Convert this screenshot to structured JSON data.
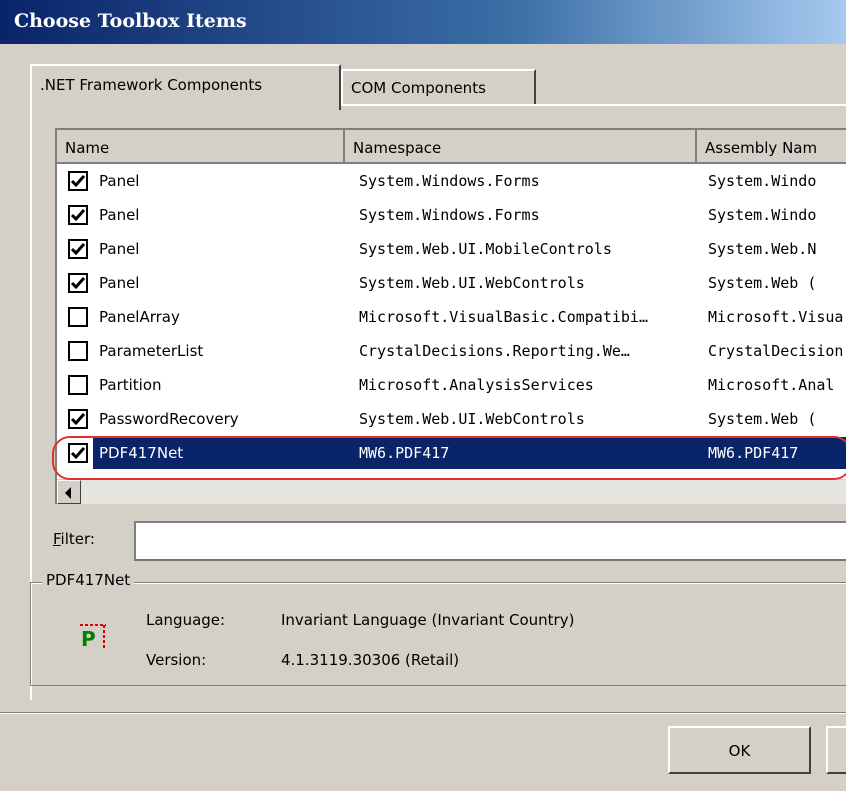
{
  "window": {
    "title": "Choose Toolbox Items"
  },
  "tabs": [
    {
      "label": ".NET Framework Components",
      "active": true
    },
    {
      "label": "COM Components",
      "active": false
    }
  ],
  "list": {
    "columns": [
      "Name",
      "Namespace",
      "Assembly Nam"
    ],
    "rows": [
      {
        "checked": true,
        "name": "Panel",
        "namespace": "System.Windows.Forms",
        "assembly": "System.Windo"
      },
      {
        "checked": true,
        "name": "Panel",
        "namespace": "System.Windows.Forms",
        "assembly": "System.Windo"
      },
      {
        "checked": true,
        "name": "Panel",
        "namespace": "System.Web.UI.MobileControls",
        "assembly": "System.Web.N"
      },
      {
        "checked": true,
        "name": "Panel",
        "namespace": "System.Web.UI.WebControls",
        "assembly": "System.Web ("
      },
      {
        "checked": false,
        "name": "PanelArray",
        "namespace": "Microsoft.VisualBasic.Compatibi…",
        "assembly": "Microsoft.Visua"
      },
      {
        "checked": false,
        "name": "ParameterList",
        "namespace": "CrystalDecisions.Reporting.We…",
        "assembly": "CrystalDecision"
      },
      {
        "checked": false,
        "name": "Partition",
        "namespace": "Microsoft.AnalysisServices",
        "assembly": "Microsoft.Anal"
      },
      {
        "checked": true,
        "name": "PasswordRecovery",
        "namespace": "System.Web.UI.WebControls",
        "assembly": "System.Web ("
      },
      {
        "checked": true,
        "name": "PDF417Net",
        "namespace": "MW6.PDF417",
        "assembly": "MW6.PDF417",
        "selected": true
      }
    ]
  },
  "filter": {
    "label": "Filter:",
    "mnemonic": "F",
    "label_rest": "ilter:",
    "value": ""
  },
  "details": {
    "title": "PDF417Net",
    "icon_glyph": "P",
    "language_label": "Language:",
    "language_value": "Invariant Language (Invariant Country)",
    "version_label": "Version:",
    "version_value": "4.1.3119.30306 (Retail)"
  },
  "buttons": {
    "ok": "OK"
  },
  "colors": {
    "selection": "#0a246a",
    "highlight_ring": "#e03030",
    "dialog_bg": "#d4d0c8"
  }
}
